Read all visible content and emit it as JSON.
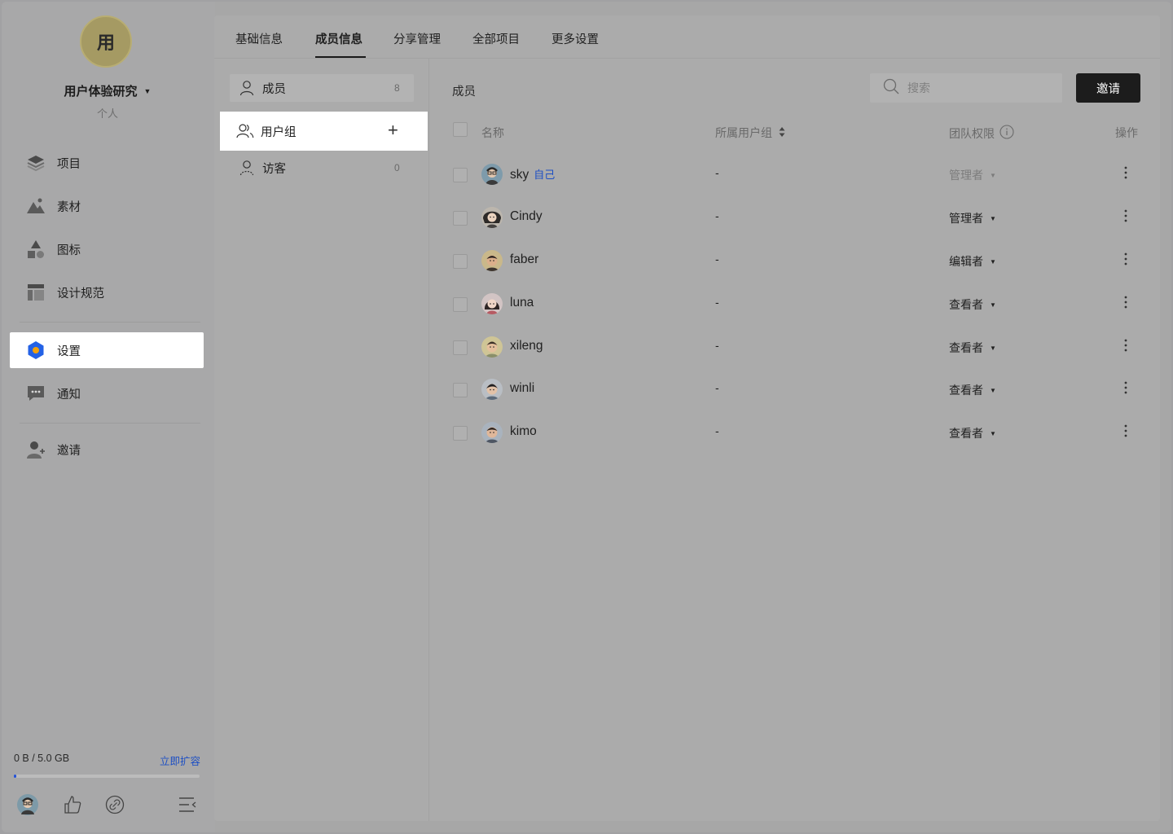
{
  "workspace": {
    "avatar_char": "用",
    "name": "用户体验研究",
    "type": "个人"
  },
  "sidebar": {
    "items": [
      {
        "label": "项目",
        "icon": "layers-icon"
      },
      {
        "label": "素材",
        "icon": "image-icon"
      },
      {
        "label": "图标",
        "icon": "shapes-icon"
      },
      {
        "label": "设计规范",
        "icon": "layout-icon"
      },
      {
        "label": "设置",
        "icon": "settings-hex-icon",
        "active": true
      },
      {
        "label": "通知",
        "icon": "chat-icon"
      },
      {
        "label": "邀请",
        "icon": "add-user-icon"
      }
    ],
    "storage": {
      "used_text": "0 B / 5.0 GB",
      "upgrade_label": "立即扩容",
      "fill_fraction": 0.01
    }
  },
  "tabs": [
    "基础信息",
    "成员信息",
    "分享管理",
    "全部项目",
    "更多设置"
  ],
  "active_tab": "成员信息",
  "subnav": {
    "items": [
      {
        "label": "成员",
        "count": "8"
      },
      {
        "label": "用户组",
        "action": "+"
      },
      {
        "label": "访客",
        "count": "0"
      }
    ]
  },
  "members": {
    "section_title": "成员",
    "search_placeholder": "搜索",
    "invite_label": "邀请",
    "columns": {
      "name": "名称",
      "group": "所属用户组",
      "permission": "团队权限",
      "actions": "操作"
    },
    "rows": [
      {
        "name": "sky",
        "tag": "自己",
        "group": "-",
        "role": "管理者",
        "disabled": true
      },
      {
        "name": "Cindy",
        "tag": "",
        "group": "-",
        "role": "管理者"
      },
      {
        "name": "faber",
        "tag": "",
        "group": "-",
        "role": "编辑者"
      },
      {
        "name": "luna",
        "tag": "",
        "group": "-",
        "role": "查看者"
      },
      {
        "name": "xileng",
        "tag": "",
        "group": "-",
        "role": "查看者"
      },
      {
        "name": "winli",
        "tag": "",
        "group": "-",
        "role": "查看者"
      },
      {
        "name": "kimo",
        "tag": "",
        "group": "-",
        "role": "查看者"
      }
    ]
  },
  "colors": {
    "accent_blue": "#1d4fc4",
    "settings_icon": "#2462e6",
    "button_dark": "#1c1c1c"
  }
}
